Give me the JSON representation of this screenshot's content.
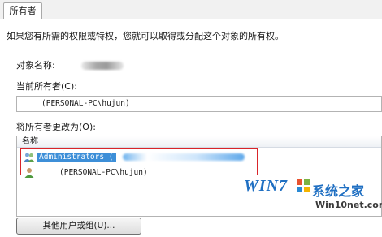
{
  "tab": {
    "label": "所有者"
  },
  "description": "如果您有所需的权限或特权，您就可以取得或分配这个对象的所有权。",
  "object_name_label": "对象名称:",
  "current_owner_label": "当前所有者(C):",
  "current_owner_value": "(PERSONAL-PC\\hujun)",
  "change_owner_label": "将所有者更改为(O):",
  "list": {
    "column_header": "名称",
    "items": [
      {
        "label": "Administrators (",
        "icon": "group-users-icon",
        "selected": true
      },
      {
        "label": "(PERSONAL-PC\\hujun)",
        "icon": "user-icon",
        "selected": false
      }
    ]
  },
  "other_users_button": "其他用户或组(U)...",
  "watermark": {
    "logo_text": "WIN7",
    "site_name": "系统之家",
    "url": "Win10net.com"
  },
  "colors": {
    "selection": "#3d8fd8",
    "highlight_border": "#d9252a",
    "watermark_blue": "#1f6fc2"
  }
}
